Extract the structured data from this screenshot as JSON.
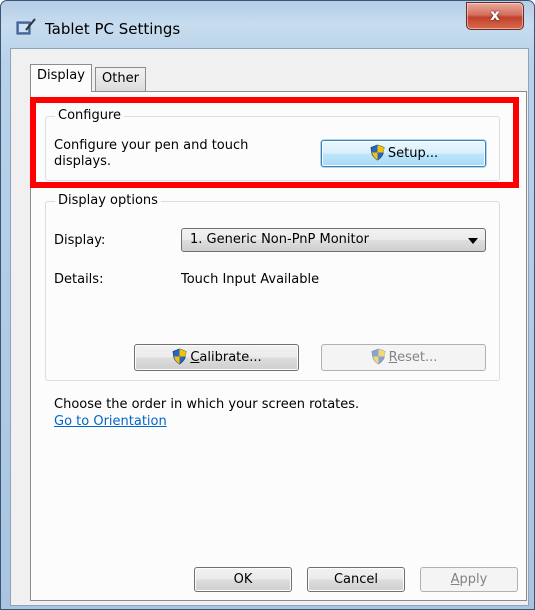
{
  "window": {
    "title": "Tablet PC Settings",
    "close_symbol": "x",
    "title_icon": "tablet-pc-icon"
  },
  "tabs": [
    {
      "label": "Display",
      "active": true
    },
    {
      "label": "Other",
      "active": false
    }
  ],
  "configure": {
    "title": "Configure",
    "text_line1": "Configure your pen and touch",
    "text_line2": "displays.",
    "setup_button": "Setup..."
  },
  "display_options": {
    "title": "Display options",
    "display_label": "Display:",
    "display_value": "1. Generic Non-PnP Monitor",
    "details_label": "Details:",
    "details_value": "Touch Input Available",
    "calibrate_prefix": "C",
    "calibrate_rest": "alibrate...",
    "reset_prefix": "R",
    "reset_rest": "eset..."
  },
  "orientation": {
    "text": "Choose the order in which your screen rotates.",
    "link": "Go to Orientation"
  },
  "footer": {
    "ok": "OK",
    "cancel": "Cancel",
    "apply_prefix": "A",
    "apply_rest": "pply"
  },
  "colors": {
    "highlight": "#ff0000",
    "link": "#0066cc",
    "shield_blue": "#2a64c5",
    "shield_yellow": "#f5c400"
  }
}
